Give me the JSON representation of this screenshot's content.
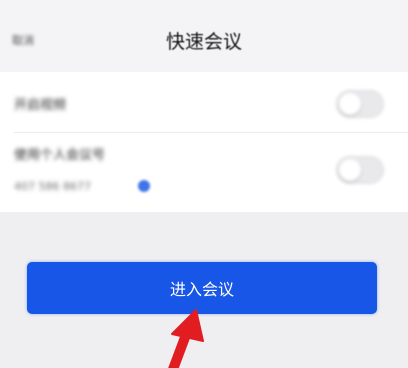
{
  "header": {
    "back_label": "取消",
    "title": "快速会议"
  },
  "settings": {
    "rows": [
      {
        "label": "开启视频",
        "toggle_on": false
      },
      {
        "label": "使用个人会议号",
        "sub_label": "407 586 8677",
        "toggle_on": false
      }
    ]
  },
  "primary_action": {
    "label": "进入会议"
  },
  "colors": {
    "accent": "#1756e6",
    "annotation_arrow": "#e11d22",
    "status_dot": "#42d57c"
  },
  "icons": {
    "annotation": "arrow-up-icon",
    "info": "info-dot-icon"
  }
}
